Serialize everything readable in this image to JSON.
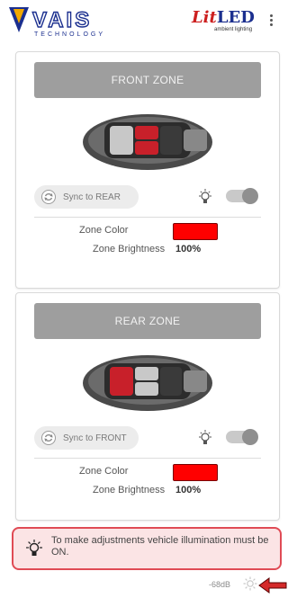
{
  "header": {
    "logo_name": "VAIS",
    "logo_tagline": "TECHNOLOGY",
    "brand_lit": "Lit",
    "brand_led": "LED",
    "brand_sub": "ambient lighting",
    "menu_icon": "kebab-menu-icon"
  },
  "front_zone": {
    "title": "FRONT ZONE",
    "sync_label": "Sync to REAR",
    "color_label": "Zone Color",
    "color_value": "#ff0000",
    "brightness_label": "Zone Brightness",
    "brightness_value": "100%",
    "toggle_on": true
  },
  "rear_zone": {
    "title": "REAR ZONE",
    "sync_label": "Sync to FRONT",
    "color_label": "Zone Color",
    "color_value": "#ff0000",
    "brightness_label": "Zone Brightness",
    "brightness_value": "100%",
    "toggle_on": true
  },
  "notice": {
    "text": "To make adjustments vehicle illumination must be ON.",
    "icon": "lightbulb-icon"
  },
  "footer": {
    "signal": "-68dB",
    "brightness_icon": "sun-icon"
  },
  "colors": {
    "accent_red": "#ff0000",
    "notice_border": "#e04b55",
    "zone_title_bg": "#9e9e9e"
  }
}
